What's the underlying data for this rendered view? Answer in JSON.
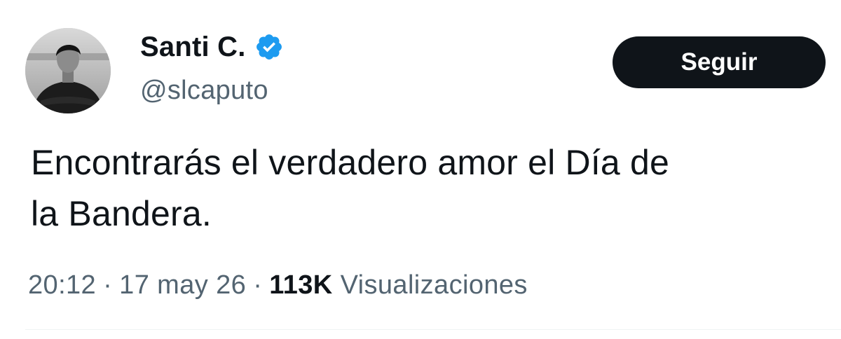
{
  "author": {
    "name": "Santi C.",
    "handle": "@slcaputo",
    "verified": true
  },
  "actions": {
    "follow_label": "Seguir"
  },
  "tweet": {
    "text_line1": "Encontrarás el verdadero amor el Día de",
    "text_line2": "la Bandera."
  },
  "meta": {
    "time": "20:12",
    "separator": "·",
    "date": "17 may 26",
    "views_count": "113K",
    "views_label": "Visualizaciones"
  },
  "colors": {
    "primary_text": "#0f1419",
    "secondary_text": "#536471",
    "verified_blue": "#1d9bf0",
    "button_bg": "#0f1419"
  },
  "icons": {
    "verified": "verified-badge-icon",
    "avatar": "profile-photo"
  }
}
